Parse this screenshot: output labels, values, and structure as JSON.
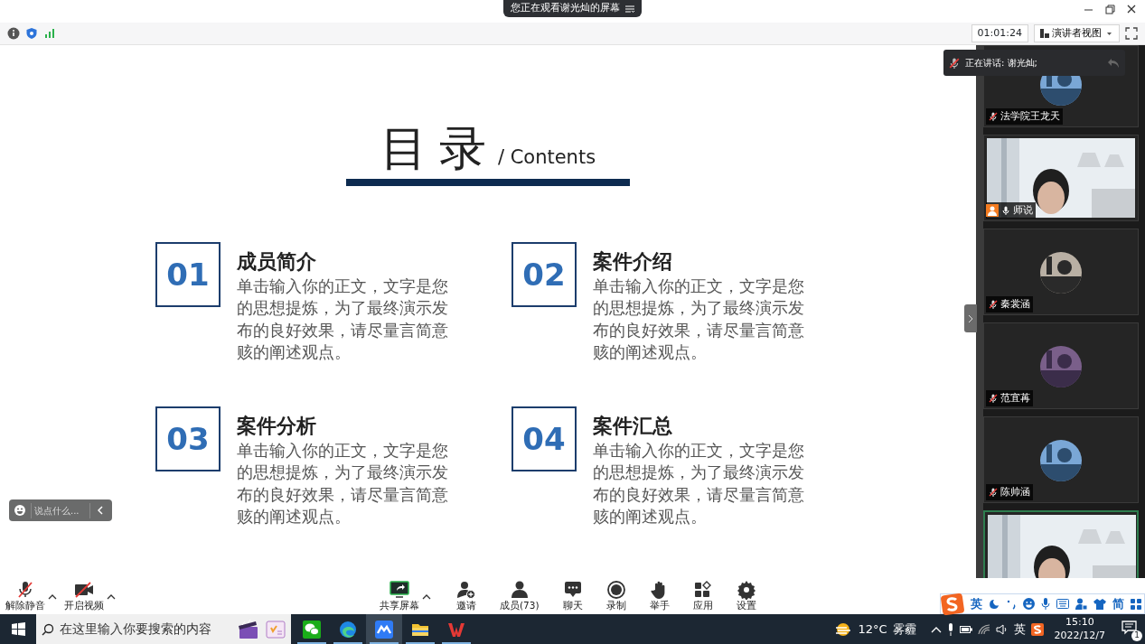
{
  "banner": {
    "text": "您正在观看谢光灿的屏幕"
  },
  "toolbar": {
    "timer": "01:01:24",
    "view_menu": "演讲者视图"
  },
  "slide": {
    "title": "目录",
    "subtitle": "/ Contents",
    "items": [
      {
        "number": "01",
        "heading": "成员简介",
        "body": "单击输入你的正文，文字是您的思想提炼，为了最终演示发布的良好效果，请尽量言简意赅的阐述观点。"
      },
      {
        "number": "02",
        "heading": "案件介绍",
        "body": "单击输入你的正文，文字是您的思想提炼，为了最终演示发布的良好效果，请尽量言简意赅的阐述观点。"
      },
      {
        "number": "03",
        "heading": "案件分析",
        "body": "单击输入你的正文，文字是您的思想提炼，为了最终演示发布的良好效果，请尽量言简意赅的阐述观点。"
      },
      {
        "number": "04",
        "heading": "案件汇总",
        "body": "单击输入你的正文，文字是您的思想提炼，为了最终演示发布的良好效果，请尽量言简意赅的阐述观点。"
      }
    ]
  },
  "speaking": {
    "label": "正在讲话: 谢光灿;"
  },
  "participants": [
    {
      "name": "法学院王龙天",
      "kind": "avatar",
      "muted": true,
      "host": false,
      "active": false
    },
    {
      "name": "师说",
      "kind": "camera",
      "muted": false,
      "host": true,
      "active": false
    },
    {
      "name": "秦裳涵",
      "kind": "avatar",
      "muted": true,
      "host": false,
      "active": false
    },
    {
      "name": "范宜苒",
      "kind": "avatar",
      "muted": true,
      "host": false,
      "active": false
    },
    {
      "name": "陈帅涵",
      "kind": "avatar",
      "muted": true,
      "host": false,
      "active": false
    },
    {
      "kind": "camera",
      "active": true
    }
  ],
  "chat": {
    "placeholder": "说点什么..."
  },
  "media_controls": [
    {
      "kind": "mic",
      "label": "解除静音",
      "menu": true
    },
    {
      "kind": "video",
      "label": "开启视频",
      "menu": true
    }
  ],
  "meeting_controls": [
    {
      "kind": "share",
      "label": "共享屏幕",
      "menu": true
    },
    {
      "kind": "invite",
      "label": "邀请",
      "menu": false
    },
    {
      "kind": "members",
      "label": "成员(73)",
      "menu": false
    },
    {
      "kind": "chat",
      "label": "聊天",
      "menu": false
    },
    {
      "kind": "record",
      "label": "录制",
      "menu": false
    },
    {
      "kind": "hand",
      "label": "举手",
      "menu": false
    },
    {
      "kind": "apps",
      "label": "应用",
      "menu": false
    },
    {
      "kind": "settings",
      "label": "设置",
      "menu": false
    }
  ],
  "ime": {
    "mode": "英",
    "script": "简"
  },
  "taskbar": {
    "search_placeholder": "在这里输入你要搜索的内容",
    "apps": [
      {
        "kind": "wechat",
        "selected": false
      },
      {
        "kind": "edge",
        "selected": false
      },
      {
        "kind": "meeting",
        "selected": true
      },
      {
        "kind": "explorer",
        "selected": false
      },
      {
        "kind": "wps",
        "selected": false
      }
    ],
    "temperature": "12°C",
    "weather": "雾霾",
    "input_lang": "英",
    "time": "15:10",
    "date": "2022/12/7",
    "notifications": "1"
  }
}
